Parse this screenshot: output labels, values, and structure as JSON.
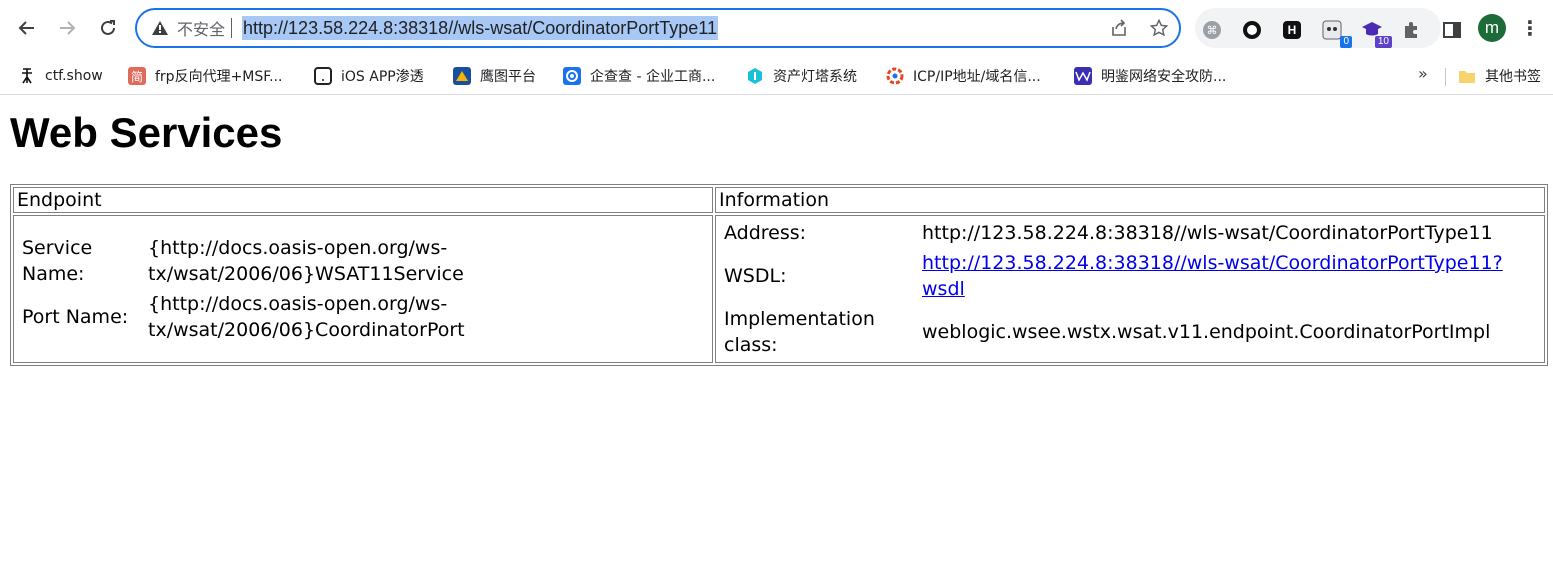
{
  "browser": {
    "address_bar": {
      "security_label": "不安全",
      "url": "http://123.58.224.8:38318//wls-wsat/CoordinatorPortType11"
    },
    "extensions": [
      {
        "name": "extension-1",
        "badge": ""
      },
      {
        "name": "extension-2",
        "badge": ""
      },
      {
        "name": "extension-3",
        "badge": "H"
      },
      {
        "name": "extension-4",
        "badge": "0"
      },
      {
        "name": "extension-5",
        "badge": "10"
      }
    ],
    "profile_initial": "m"
  },
  "bookmarks": [
    {
      "label": "ctf.show",
      "icon_text": "",
      "icon_color": "#ffffff"
    },
    {
      "label": "frp反向代理+MSF...",
      "icon_text": "简",
      "icon_color": "#e06b5b"
    },
    {
      "label": "iOS APP渗透",
      "icon_text": "",
      "icon_color": "#222222"
    },
    {
      "label": "鹰图平台",
      "icon_text": "",
      "icon_color": "#f4b400"
    },
    {
      "label": "企查查 - 企业工商...",
      "icon_text": "",
      "icon_color": "#1a73e8"
    },
    {
      "label": "资产灯塔系统",
      "icon_text": "",
      "icon_color": "#19c1d6"
    },
    {
      "label": "ICP/IP地址/域名信...",
      "icon_text": "",
      "icon_color": "#e8471d"
    },
    {
      "label": "明鉴网络安全攻防...",
      "icon_text": "",
      "icon_color": "#3a2fb2"
    }
  ],
  "bookmarks_other": "其他书签",
  "page": {
    "title": "Web Services",
    "table": {
      "headers": {
        "endpoint": "Endpoint",
        "information": "Information"
      },
      "endpoint": {
        "service_name_label": "Service Name:",
        "service_name_value": "{http://docs.oasis-open.org/ws-tx/wsat/2006/06}WSAT11Service",
        "port_name_label": "Port Name:",
        "port_name_value": "{http://docs.oasis-open.org/ws-tx/wsat/2006/06}CoordinatorPort"
      },
      "information": {
        "address_label": "Address:",
        "address_value": "http://123.58.224.8:38318//wls-wsat/CoordinatorPortType11",
        "wsdl_label": "WSDL:",
        "wsdl_value": "http://123.58.224.8:38318//wls-wsat/CoordinatorPortType11?wsdl",
        "impl_label": "Implementation class:",
        "impl_value": "weblogic.wsee.wstx.wsat.v11.endpoint.CoordinatorPortImpl"
      }
    }
  }
}
